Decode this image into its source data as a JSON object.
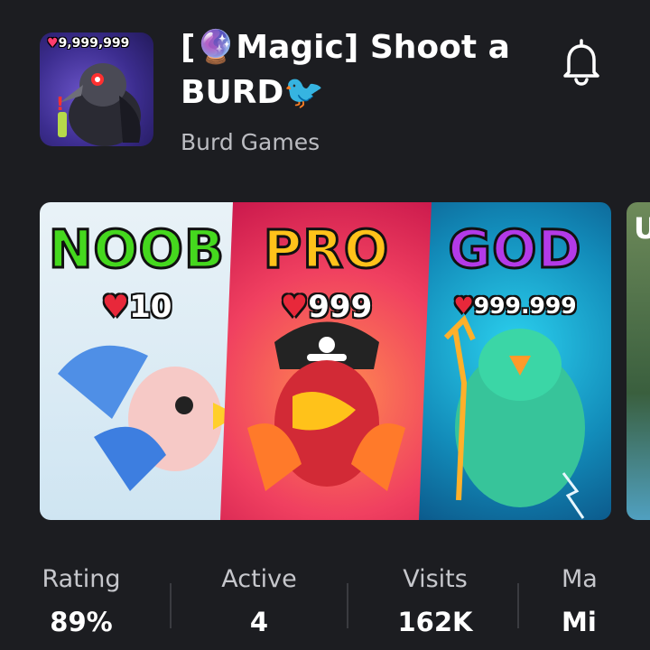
{
  "game": {
    "title": "[🔮Magic] Shoot a BURD🐦",
    "publisher": "Burd Games",
    "icon_badge": "9,999,999"
  },
  "thumbnail": {
    "panels": [
      {
        "tier": "NOOB",
        "hp": "10"
      },
      {
        "tier": "PRO",
        "hp": "999"
      },
      {
        "tier": "GOD",
        "hp": "999.999"
      }
    ],
    "next_peek": "U"
  },
  "stats": [
    {
      "label": "Rating",
      "value": "89%"
    },
    {
      "label": "Active",
      "value": "4"
    },
    {
      "label": "Visits",
      "value": "162K"
    },
    {
      "label": "Ma",
      "value": "Mi"
    }
  ],
  "icons": [
    "game-icon",
    "bell-icon",
    "heart-icon"
  ],
  "colors": {
    "background": "#1c1d21",
    "noob": "#45d81e",
    "pro": "#ffc21a",
    "god": "#b33ae8",
    "heart": "#e8283a"
  }
}
